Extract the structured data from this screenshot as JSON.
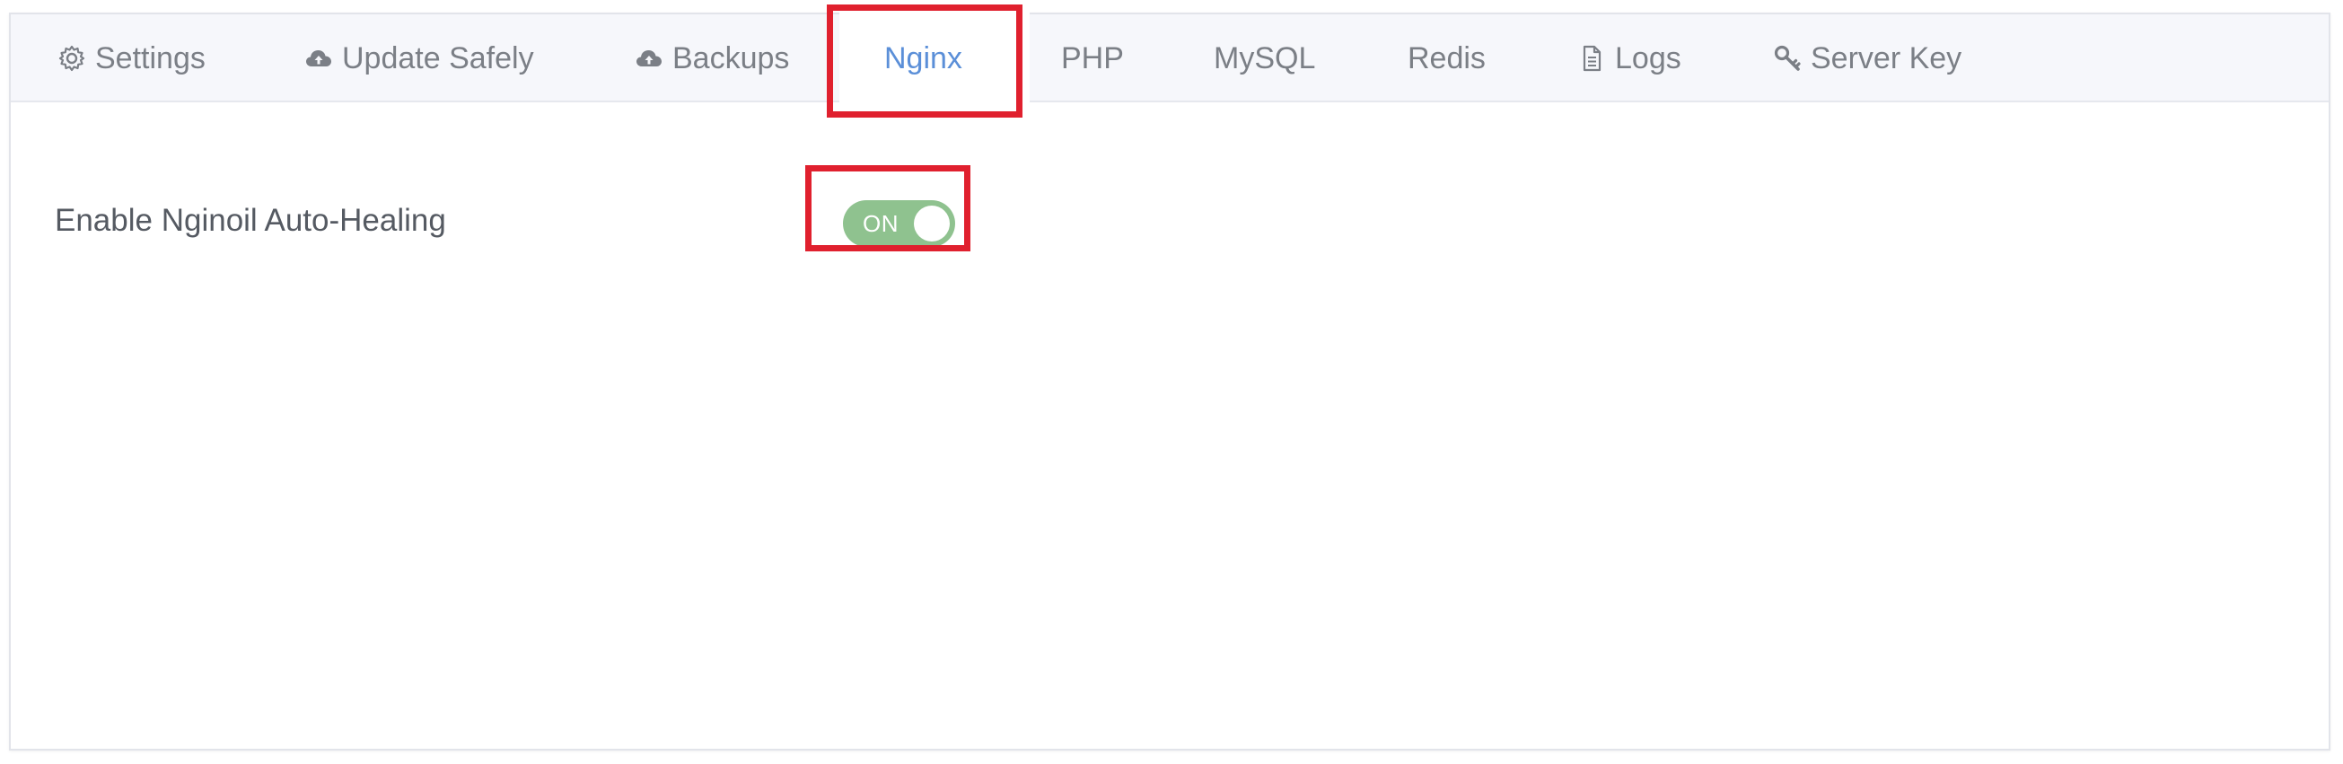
{
  "tabs": [
    {
      "label": "Settings",
      "icon": "gear-icon"
    },
    {
      "label": "Update Safely",
      "icon": "cloud-upload-icon"
    },
    {
      "label": "Backups",
      "icon": "cloud-upload-icon"
    },
    {
      "label": "Nginx",
      "icon": ""
    },
    {
      "label": "PHP",
      "icon": ""
    },
    {
      "label": "MySQL",
      "icon": ""
    },
    {
      "label": "Redis",
      "icon": ""
    },
    {
      "label": "Logs",
      "icon": "document-icon"
    },
    {
      "label": "Server Key",
      "icon": "key-icon"
    }
  ],
  "active_tab": "Nginx",
  "setting": {
    "label": "Enable Nginoil Auto-Healing",
    "toggle_text": "ON",
    "enabled": true
  },
  "colors": {
    "active_tab": "#5b8fd8",
    "tab_text": "#7b7f86",
    "toggle_on": "#8fc28f",
    "highlight": "#e0202e"
  }
}
